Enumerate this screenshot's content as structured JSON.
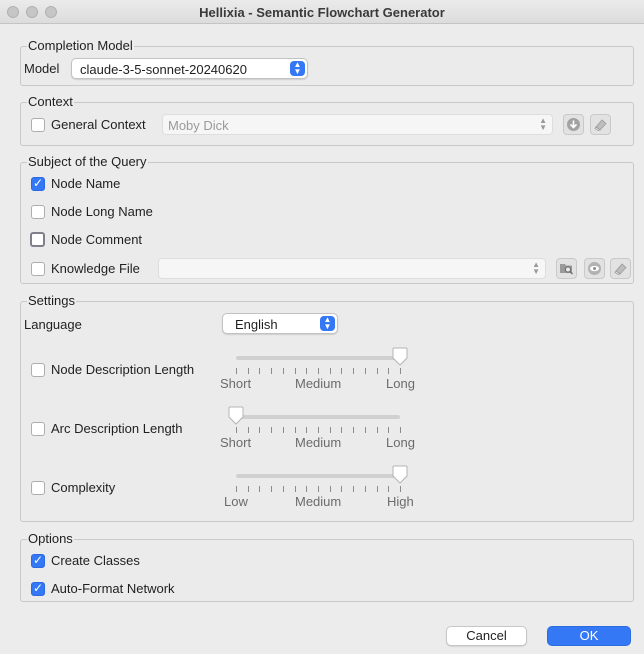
{
  "window": {
    "title": "Hellixia - Semantic Flowchart Generator"
  },
  "completion_model": {
    "legend": "Completion Model",
    "model_label": "Model",
    "model_value": "claude-3-5-sonnet-20240620"
  },
  "context": {
    "legend": "Context",
    "general_context_label": "General Context",
    "general_context_checked": false,
    "general_context_value": "Moby Dick"
  },
  "subject": {
    "legend": "Subject of the Query",
    "node_name": {
      "label": "Node Name",
      "checked": true
    },
    "node_long_name": {
      "label": "Node Long Name",
      "checked": false
    },
    "node_comment": {
      "label": "Node Comment",
      "checked": false
    },
    "knowledge_file": {
      "label": "Knowledge File",
      "checked": false,
      "value": ""
    }
  },
  "settings": {
    "legend": "Settings",
    "language_label": "Language",
    "language_value": "English",
    "node_description_length": {
      "label": "Node Description Length",
      "checked": false,
      "ticks": [
        "Short",
        "Medium",
        "Long"
      ],
      "value": 1.0
    },
    "arc_description_length": {
      "label": "Arc Description Length",
      "checked": false,
      "ticks": [
        "Short",
        "Medium",
        "Long"
      ],
      "value": 0.0
    },
    "complexity": {
      "label": "Complexity",
      "checked": false,
      "ticks": [
        "Low",
        "Medium",
        "High"
      ],
      "value": 1.0
    }
  },
  "options": {
    "legend": "Options",
    "create_classes": {
      "label": "Create Classes",
      "checked": true
    },
    "auto_format_network": {
      "label": "Auto-Format Network",
      "checked": true
    }
  },
  "buttons": {
    "cancel": "Cancel",
    "ok": "OK"
  },
  "colors": {
    "accent": "#3478f6",
    "background": "#ececec"
  }
}
